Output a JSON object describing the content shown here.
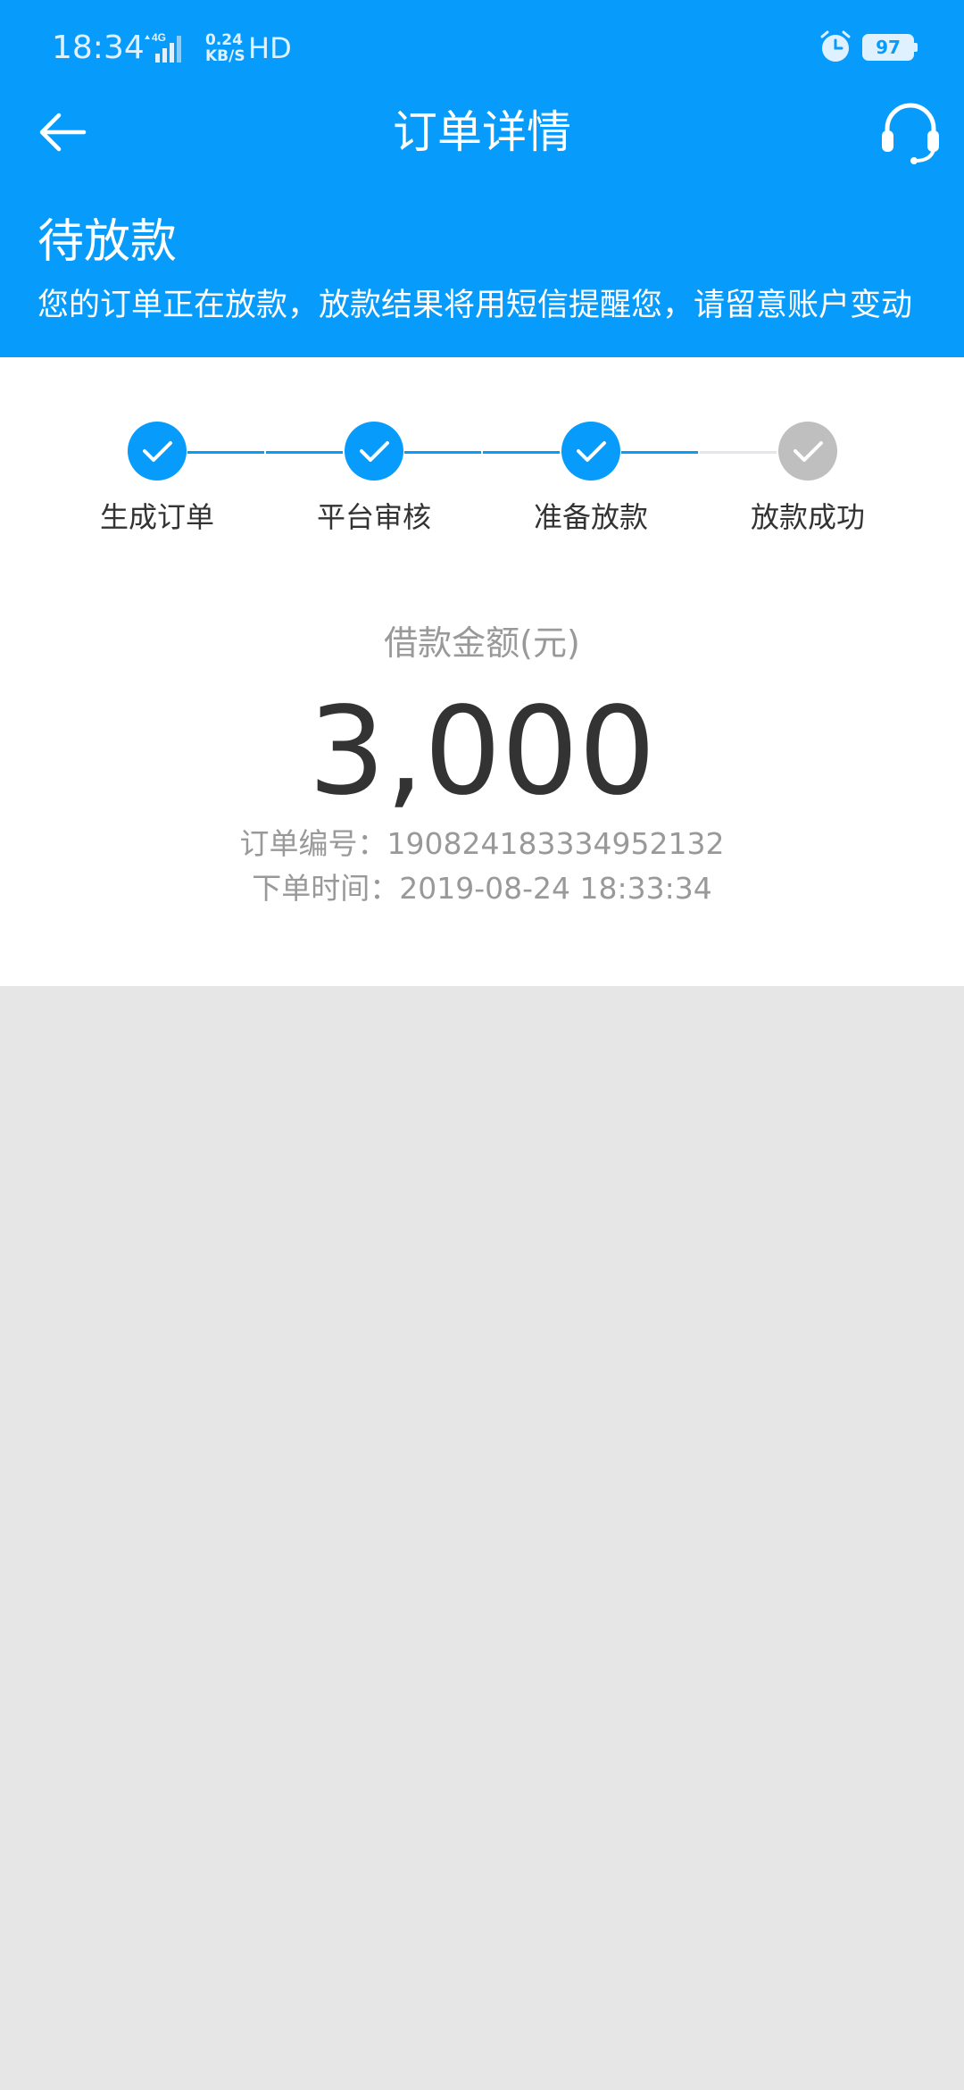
{
  "status_bar": {
    "time": "18:34",
    "network_type": "4G",
    "speed_value": "0.24",
    "speed_unit": "KB/S",
    "hd_label": "HD",
    "battery": "97"
  },
  "nav": {
    "title": "订单详情"
  },
  "order_status": {
    "title": "待放款",
    "description": "您的订单正在放款，放款结果将用短信提醒您，请留意账户变动"
  },
  "steps": [
    {
      "label": "生成订单",
      "done": true
    },
    {
      "label": "平台审核",
      "done": true
    },
    {
      "label": "准备放款",
      "done": true
    },
    {
      "label": "放款成功",
      "done": false
    }
  ],
  "loan": {
    "amount_label": "借款金额(元)",
    "amount": "3,000",
    "order_number": "订单编号：190824183334952132",
    "order_time": "下单时间：2019-08-24 18:33:34"
  },
  "colors": {
    "brand_blue": "#079cfb",
    "step_pending": "#bfbfbf",
    "line_pending": "#e3e7ec",
    "page_bg": "#e6e6e6"
  }
}
